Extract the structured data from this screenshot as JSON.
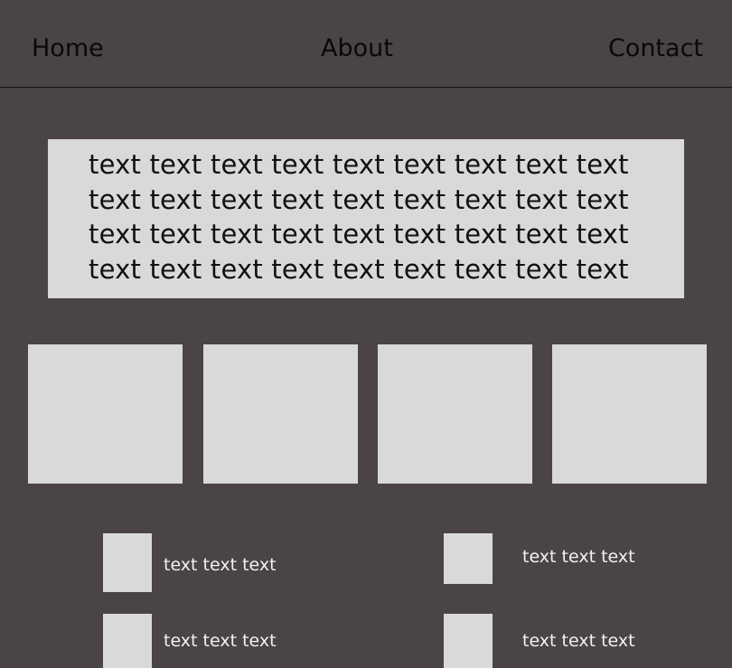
{
  "nav": {
    "items": [
      {
        "label": "Home"
      },
      {
        "label": "About"
      },
      {
        "label": "Contact"
      }
    ]
  },
  "hero": {
    "lines": [
      "text text text text text text text text text",
      "text text text text text text text text text",
      "text text text text text text text text text",
      "text text text text text text text text text"
    ]
  },
  "items": [
    {
      "label": "text text text"
    },
    {
      "label": "text text text"
    },
    {
      "label": "text text text"
    },
    {
      "label": "text text text"
    }
  ],
  "colors": {
    "background": "#4b4444",
    "placeholder": "#d9d9d9",
    "nav_text": "#0b0808",
    "hero_text": "#141010",
    "item_text": "#f4f0f0"
  }
}
